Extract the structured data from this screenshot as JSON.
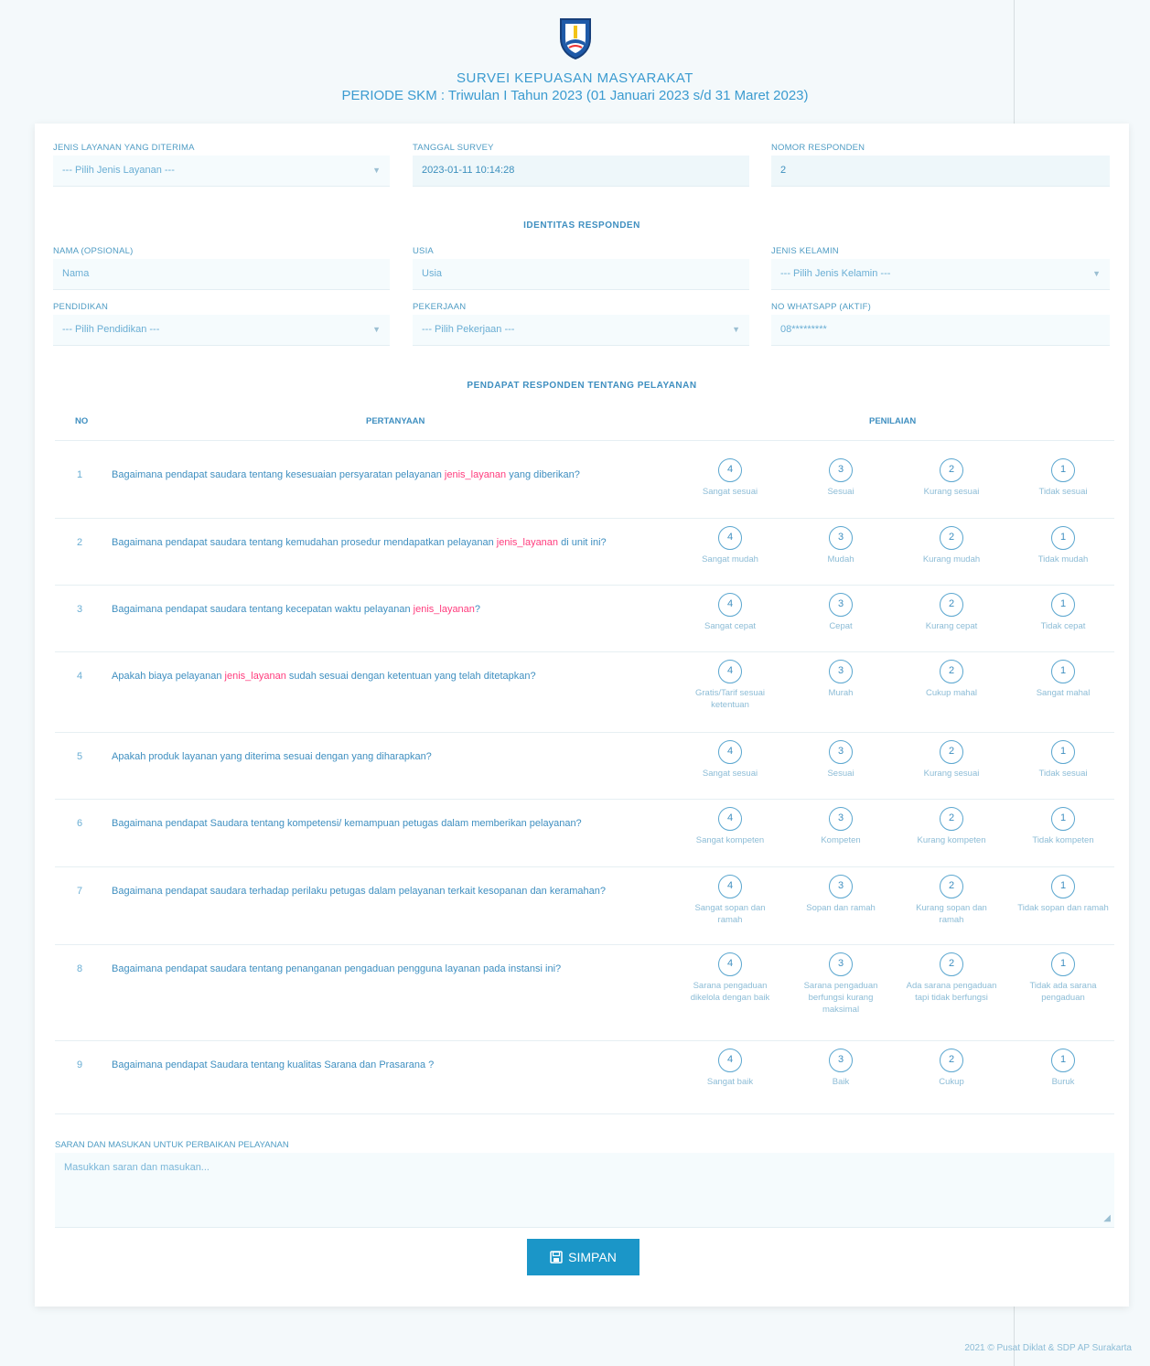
{
  "header": {
    "title": "SURVEI KEPUASAN MASYARAKAT",
    "period": "PERIODE SKM : Triwulan I Tahun 2023 (01 Januari 2023 s/d 31 Maret 2023)"
  },
  "top_fields": {
    "jenis_layanan_label": "JENIS LAYANAN YANG DITERIMA",
    "jenis_layanan_value": "--- Pilih Jenis Layanan ---",
    "tanggal_label": "TANGGAL SURVEY",
    "tanggal_value": "2023-01-11 10:14:28",
    "nomor_label": "NOMOR RESPONDEN",
    "nomor_value": "2"
  },
  "identitas": {
    "title": "IDENTITAS RESPONDEN",
    "nama_label": "NAMA (OPSIONAL)",
    "nama_placeholder": "Nama",
    "usia_label": "USIA",
    "usia_placeholder": "Usia",
    "jk_label": "JENIS KELAMIN",
    "jk_value": "--- Pilih Jenis Kelamin ---",
    "pendidikan_label": "PENDIDIKAN",
    "pendidikan_value": "--- Pilih Pendidikan ---",
    "pekerjaan_label": "PEKERJAAN",
    "pekerjaan_value": "--- Pilih Pekerjaan ---",
    "wa_label": "NO WHATSAPP (AKTIF)",
    "wa_placeholder": "08*********"
  },
  "pendapat": {
    "title": "PENDAPAT RESPONDEN TENTANG PELAYANAN",
    "col_no": "NO",
    "col_q": "PERTANYAAN",
    "col_score": "PENILAIAN"
  },
  "questions": [
    {
      "no": "1",
      "pre": "Bagaimana pendapat saudara tentang kesesuaian persyaratan pelayanan ",
      "hl": "jenis_layanan",
      "post": " yang diberikan?",
      "options": [
        {
          "v": "4",
          "l": "Sangat sesuai"
        },
        {
          "v": "3",
          "l": "Sesuai"
        },
        {
          "v": "2",
          "l": "Kurang sesuai"
        },
        {
          "v": "1",
          "l": "Tidak sesuai"
        }
      ]
    },
    {
      "no": "2",
      "pre": "Bagaimana pendapat saudara tentang kemudahan prosedur mendapatkan pelayanan ",
      "hl": "jenis_layanan",
      "post": " di unit ini?",
      "options": [
        {
          "v": "4",
          "l": "Sangat mudah"
        },
        {
          "v": "3",
          "l": "Mudah"
        },
        {
          "v": "2",
          "l": "Kurang mudah"
        },
        {
          "v": "1",
          "l": "Tidak mudah"
        }
      ]
    },
    {
      "no": "3",
      "pre": "Bagaimana pendapat saudara tentang kecepatan waktu pelayanan ",
      "hl": "jenis_layanan",
      "post": "?",
      "options": [
        {
          "v": "4",
          "l": "Sangat cepat"
        },
        {
          "v": "3",
          "l": "Cepat"
        },
        {
          "v": "2",
          "l": "Kurang cepat"
        },
        {
          "v": "1",
          "l": "Tidak cepat"
        }
      ]
    },
    {
      "no": "4",
      "pre": "Apakah biaya pelayanan ",
      "hl": "jenis_layanan",
      "post": " sudah sesuai dengan ketentuan yang telah ditetapkan?",
      "options": [
        {
          "v": "4",
          "l": "Gratis/Tarif sesuai ketentuan"
        },
        {
          "v": "3",
          "l": "Murah"
        },
        {
          "v": "2",
          "l": "Cukup mahal"
        },
        {
          "v": "1",
          "l": "Sangat mahal"
        }
      ]
    },
    {
      "no": "5",
      "pre": "Apakah produk layanan yang diterima sesuai dengan yang diharapkan?",
      "hl": "",
      "post": "",
      "options": [
        {
          "v": "4",
          "l": "Sangat sesuai"
        },
        {
          "v": "3",
          "l": "Sesuai"
        },
        {
          "v": "2",
          "l": "Kurang sesuai"
        },
        {
          "v": "1",
          "l": "Tidak sesuai"
        }
      ]
    },
    {
      "no": "6",
      "pre": "Bagaimana pendapat Saudara tentang kompetensi/ kemampuan petugas dalam memberikan pelayanan?",
      "hl": "",
      "post": "",
      "options": [
        {
          "v": "4",
          "l": "Sangat kompeten"
        },
        {
          "v": "3",
          "l": "Kompeten"
        },
        {
          "v": "2",
          "l": "Kurang kompeten"
        },
        {
          "v": "1",
          "l": "Tidak kompeten"
        }
      ]
    },
    {
      "no": "7",
      "pre": "Bagaimana pendapat saudara terhadap perilaku petugas dalam pelayanan terkait kesopanan dan keramahan?",
      "hl": "",
      "post": "",
      "options": [
        {
          "v": "4",
          "l": "Sangat sopan dan ramah"
        },
        {
          "v": "3",
          "l": "Sopan dan ramah"
        },
        {
          "v": "2",
          "l": "Kurang sopan dan ramah"
        },
        {
          "v": "1",
          "l": "Tidak sopan dan ramah"
        }
      ]
    },
    {
      "no": "8",
      "pre": "Bagaimana pendapat saudara tentang penanganan pengaduan pengguna layanan pada instansi ini?",
      "hl": "",
      "post": "",
      "options": [
        {
          "v": "4",
          "l": "Sarana pengaduan dikelola dengan baik"
        },
        {
          "v": "3",
          "l": "Sarana pengaduan berfungsi kurang maksimal"
        },
        {
          "v": "2",
          "l": "Ada sarana pengaduan tapi tidak berfungsi"
        },
        {
          "v": "1",
          "l": "Tidak ada sarana pengaduan"
        }
      ]
    },
    {
      "no": "9",
      "pre": "Bagaimana pendapat Saudara tentang kualitas Sarana dan Prasarana ?",
      "hl": "",
      "post": "",
      "options": [
        {
          "v": "4",
          "l": "Sangat baik"
        },
        {
          "v": "3",
          "l": "Baik"
        },
        {
          "v": "2",
          "l": "Cukup"
        },
        {
          "v": "1",
          "l": "Buruk"
        }
      ]
    }
  ],
  "saran": {
    "label": "SARAN DAN MASUKAN UNTUK PERBAIKAN PELAYANAN",
    "placeholder": "Masukkan saran dan masukan..."
  },
  "submit_label": "SIMPAN",
  "footer": "2021 © Pusat Diklat & SDP AP Surakarta",
  "colors": {
    "accent": "#1b96c8",
    "highlight": "#ff3c7d"
  },
  "icons": {
    "logo": "shield-logo-icon",
    "save": "floppy-disk-icon"
  }
}
